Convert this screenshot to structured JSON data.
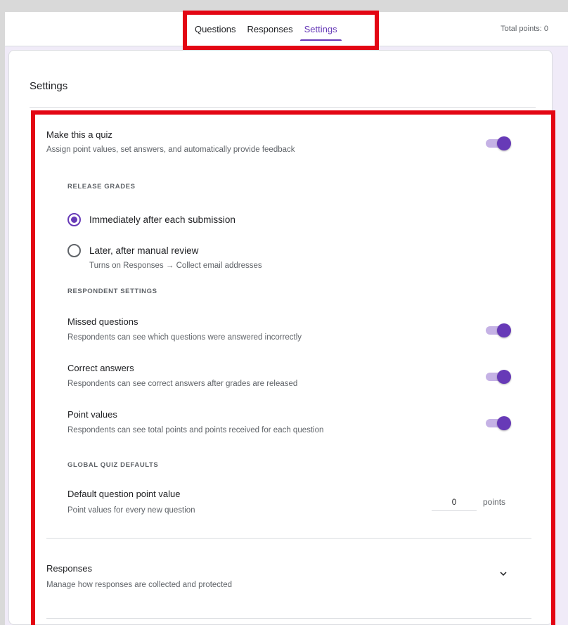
{
  "header": {
    "tabs": [
      {
        "label": "Questions",
        "active": false
      },
      {
        "label": "Responses",
        "active": false
      },
      {
        "label": "Settings",
        "active": true
      }
    ],
    "total_points": "Total points: 0"
  },
  "settings": {
    "title": "Settings",
    "quiz": {
      "title": "Make this a quiz",
      "description": "Assign point values, set answers, and automatically provide feedback",
      "enabled": true
    },
    "release_grades": {
      "label": "RELEASE GRADES",
      "options": [
        {
          "label": "Immediately after each submission",
          "checked": true
        },
        {
          "label": "Later, after manual review",
          "sublabel": "Turns on Responses → Collect email addresses",
          "checked": false
        }
      ]
    },
    "respondent_settings": {
      "label": "RESPONDENT SETTINGS",
      "items": [
        {
          "title": "Missed questions",
          "description": "Respondents can see which questions were answered incorrectly",
          "enabled": true
        },
        {
          "title": "Correct answers",
          "description": "Respondents can see correct answers after grades are released",
          "enabled": true
        },
        {
          "title": "Point values",
          "description": "Respondents can see total points and points received for each question",
          "enabled": true
        }
      ]
    },
    "global_defaults": {
      "label": "GLOBAL QUIZ DEFAULTS",
      "title": "Default question point value",
      "description": "Point values for every new question",
      "value": "0",
      "suffix": "points"
    },
    "responses": {
      "title": "Responses",
      "description": "Manage how responses are collected and protected"
    }
  },
  "colors": {
    "accent": "#673ab7",
    "highlight": "#e30613",
    "page_bg": "#f0ebf8"
  }
}
